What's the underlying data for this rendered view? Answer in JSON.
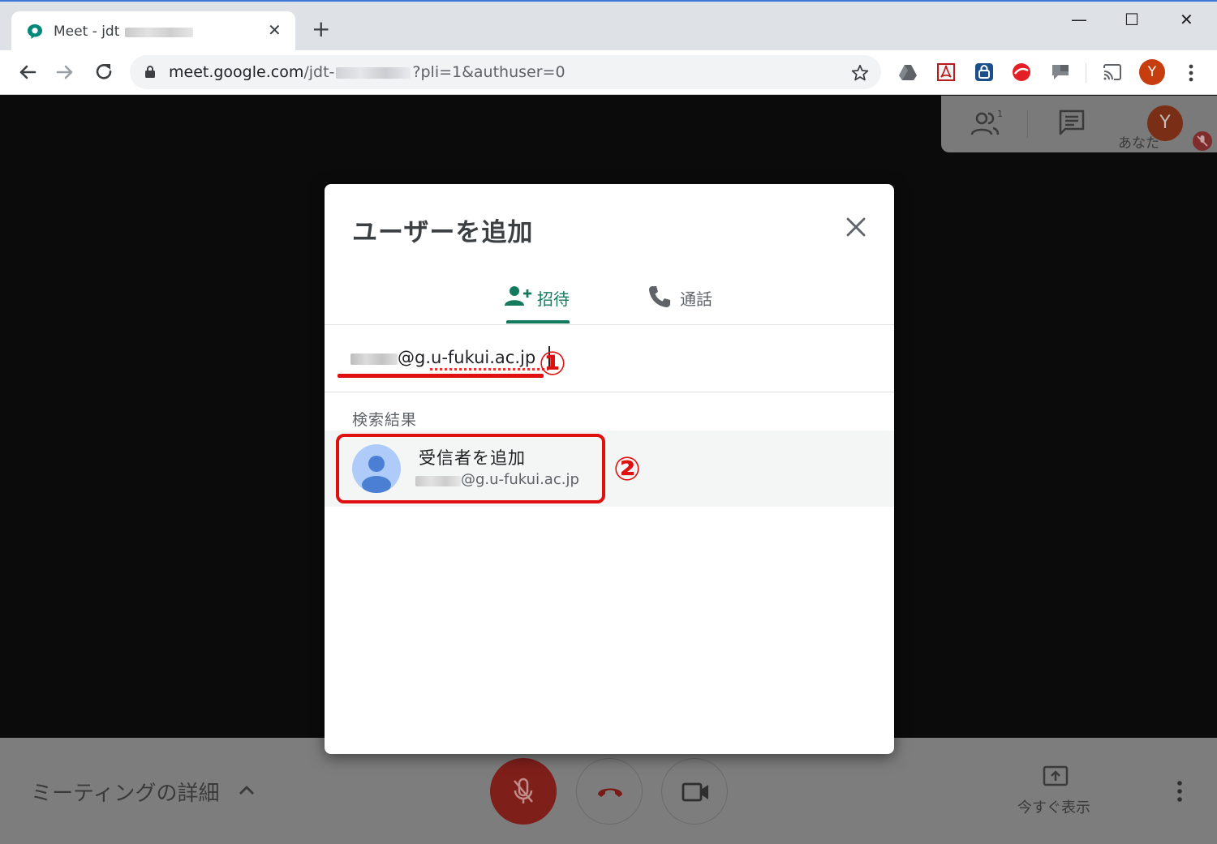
{
  "browser": {
    "tab_title": "Meet - jdt",
    "tab_close": "✕",
    "new_tab": "+",
    "window_controls": {
      "minimize": "—",
      "maximize": "☐",
      "close": "✕"
    },
    "url": {
      "host": "meet.google.com",
      "path_start": "/jdt-",
      "path_end": "?pli=1&authuser=0"
    },
    "profile_initial": "Y",
    "icons": [
      "back-icon",
      "forward-icon",
      "reload-icon",
      "lock-icon",
      "star-icon",
      "drive-icon",
      "pdf-icon",
      "lock-extension-icon",
      "trend-micro-icon",
      "chat-extension-icon",
      "cast-icon",
      "more-icon"
    ]
  },
  "meet": {
    "you_initial": "Y",
    "you_label": "あなた",
    "meeting_details": "ミーティングの詳細",
    "present_now": "今すぐ表示",
    "participants_count": "1"
  },
  "dialog": {
    "title": "ユーザーを追加",
    "tabs": [
      {
        "label": "招待",
        "active": true
      },
      {
        "label": "通話",
        "active": false
      }
    ],
    "email_input_value": "@g.u-fukui.ac.jp",
    "results_label": "検索結果",
    "result": {
      "title": "受信者を追加",
      "email": "@g.u-fukui.ac.jp"
    }
  },
  "annotations": {
    "step1": "①",
    "step2": "②",
    "color": "#e01010"
  },
  "colors": {
    "meet_green": "#137a5e",
    "chrome_tabstrip": "#dee1e6",
    "mic_off_red": "#7f1f1a"
  }
}
